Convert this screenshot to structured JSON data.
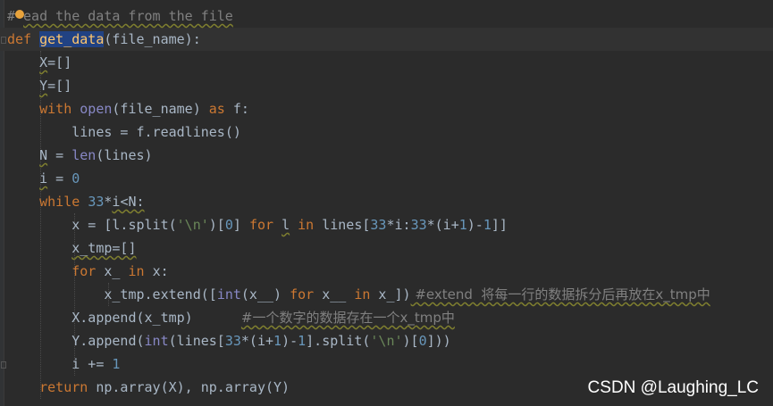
{
  "lines": [
    "#read the data from the file",
    "def get_data(file_name):",
    "    X=[]",
    "    Y=[]",
    "    with open(file_name) as f:",
    "        lines = f.readlines()",
    "    N = len(lines)",
    "    i = 0",
    "    while 33*i<N:",
    "        x = [l.split('\\n')[0] for l in lines[33*i:33*(i+1)-1]]",
    "        x_tmp=[]",
    "        for x_ in x:",
    "            x_tmp.extend([int(x__) for x__ in x_])",
    "        X.append(x_tmp)",
    "        Y.append(int(lines[33*(i+1)-1].split('\\n')[0]))",
    "        i += 1",
    "    return np.array(X), np.array(Y)"
  ],
  "code": {
    "comment_head": "#",
    "comment_rest": "ead the data from the file",
    "def_kw": "def",
    "fn_name": "get_data",
    "fn_params": "(file_name):",
    "x_var": "X",
    "y_var": "Y",
    "list_init": "=[]",
    "with_kw": "with",
    "open_fn": "open",
    "open_arg": "(file_name)",
    "as_kw": "as",
    "f_var": "f:",
    "readlines_stmt": "lines = f.readlines()",
    "n_var": "N",
    "assign": " = ",
    "len_fn": "len",
    "len_arg": "(lines)",
    "i_var": "i",
    "zero": "0",
    "while_kw": "while",
    "num33": "33",
    "star": "*",
    "lt_n": "<N:",
    "l9_a": "x = [l.split(",
    "l9_str": "'\\n'",
    "l9_b": ")[",
    "l9_c": "] ",
    "for_kw": "for",
    "l_var": "l",
    "in_kw": "in",
    "l9_d": " lines[",
    "l9_e": "*i:",
    "l9_f": "*(i+",
    "one": "1",
    "l9_g": ")-",
    "l9_h": "]]",
    "xtmp_init": "x_tmp=[]",
    "for_x_a": "x_",
    "for_x_b": "x:",
    "extend_a": "x_tmp.extend([",
    "int_fn": "int",
    "extend_b": "(x__) ",
    "extend_c": " x__ ",
    "extend_d": " x_])",
    "extend_comment": " #extend  将每一行的数据拆分后再放在x_tmp中",
    "append_x": "X.append(x_tmp)",
    "append_x_comment": "#一个数字的数据存在一个x_tmp中",
    "append_y_a": "Y.append(",
    "append_y_b": "(lines[",
    "append_y_c": "].split(",
    "append_y_d": ")[",
    "append_y_e": "]))",
    "incr": "i += ",
    "return_kw": "return",
    "return_rest": " np.array(X), np.array(Y)"
  },
  "watermark": "CSDN @Laughing_LC"
}
